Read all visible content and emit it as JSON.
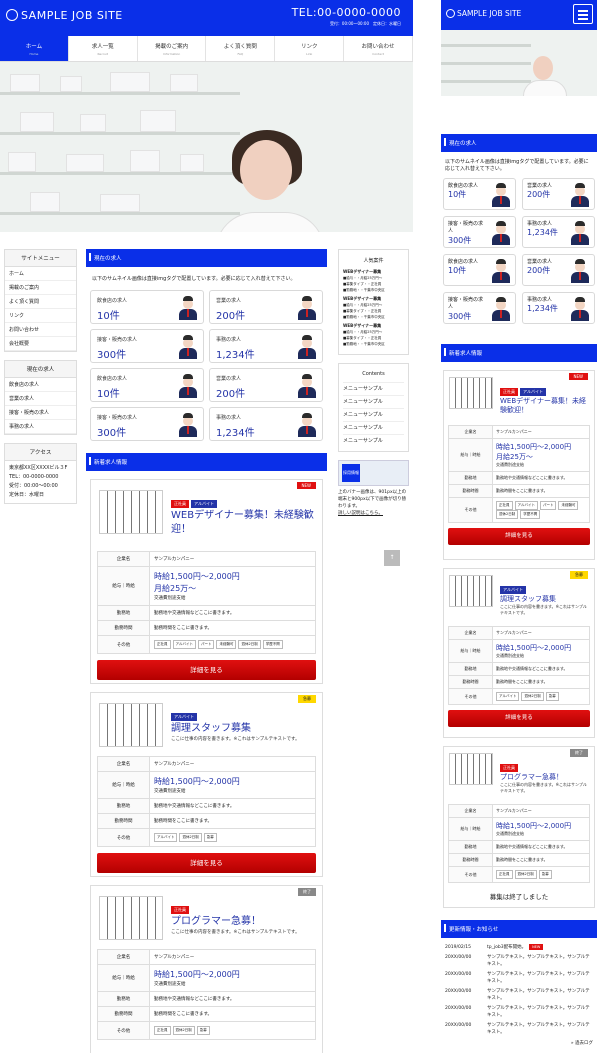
{
  "site": {
    "logo": "SAMPLE JOB SITE",
    "tel": "TEL:00-0000-0000",
    "hours": "受付：00:00〜00:00　定休日：水曜日"
  },
  "nav": [
    {
      "label": "ホーム",
      "sub": "Home"
    },
    {
      "label": "求人一覧",
      "sub": "Recruit"
    },
    {
      "label": "掲載のご案内",
      "sub": "Information"
    },
    {
      "label": "よく頂く質問",
      "sub": "FAQ"
    },
    {
      "label": "リンク",
      "sub": "Link"
    },
    {
      "label": "お問い合わせ",
      "sub": "Contact"
    }
  ],
  "sidebar": {
    "menu_title": "サイトメニュー",
    "menu": [
      "ホーム",
      "掲載のご案内",
      "よく頂く質問",
      "リンク",
      "お問い合わせ",
      "会社概要"
    ],
    "jobs_title": "現在の求人",
    "jobs": [
      "飲食店の求人",
      "営業の求人",
      "接客・販売の求人",
      "事務の求人"
    ],
    "access_title": "アクセス",
    "access": [
      "東京都XX区XXXXビル３F",
      "TEL：00-0000-0000",
      "受付：00:00〜00:00",
      "定休日：水曜日"
    ]
  },
  "current": {
    "title": "現在の求人",
    "note": "以下のサムネイル画像は直接imgタグで配置しています。必要に応じて入れ替えて下さい。",
    "cards": [
      {
        "label": "飲食店の求人",
        "value": "10件"
      },
      {
        "label": "営業の求人",
        "value": "200件"
      },
      {
        "label": "接客・販売の求人",
        "value": "300件"
      },
      {
        "label": "事務の求人",
        "value": "1,234件"
      },
      {
        "label": "飲食店の求人",
        "value": "10件"
      },
      {
        "label": "営業の求人",
        "value": "200件"
      },
      {
        "label": "接客・販売の求人",
        "value": "300件"
      },
      {
        "label": "事務の求人",
        "value": "1,234件"
      }
    ]
  },
  "newjobs": {
    "title": "新着求人情報",
    "keys": {
      "company": "企業名",
      "pay": "給与｜時給",
      "place": "勤務地",
      "time": "勤務時間",
      "other": "その他"
    },
    "detail": "詳細を見る",
    "ended": "募集は終了しました",
    "items": [
      {
        "badges": [
          "正社員",
          "アルバイト"
        ],
        "ribbon": "NEW",
        "title": "WEBデザイナー募集！未経験歓迎！",
        "desc": "",
        "company": "サンプルカンパニー",
        "pay": "時給1,500円〜2,000円",
        "pay2": "月給25万〜",
        "pay_note": "交通費別途支給",
        "place": "勤務地や交通情報などここに書きます。",
        "time": "勤務時間をここに書きます。",
        "chips": [
          "正社員",
          "アルバイト",
          "パート",
          "未経験可",
          "週休2日制",
          "学歴不問"
        ]
      },
      {
        "badges": [
          "アルバイト"
        ],
        "ribbon": "急募",
        "title": "調理スタッフ募集",
        "desc": "ここに仕事の内容を書きます。※これはサンプルテキストです。",
        "company": "サンプルカンパニー",
        "pay": "時給1,500円〜2,000円",
        "pay2": "",
        "pay_note": "交通費別途支給",
        "place": "勤務地や交通情報などここに書きます。",
        "time": "勤務時間をここに書きます。",
        "chips": [
          "アルバイト",
          "週休2日制",
          "急募"
        ]
      },
      {
        "badges": [
          "正社員"
        ],
        "ribbon": "終了",
        "title": "プログラマー急募！",
        "desc": "ここに仕事の内容を書きます。※これはサンプルテキストです。",
        "company": "サンプルカンパニー",
        "pay": "時給1,500円〜2,000円",
        "pay2": "",
        "pay_note": "交通費別途支給",
        "place": "勤務地や交通情報などここに書きます。",
        "time": "勤務時間をここに書きます。",
        "chips": [
          "正社員",
          "週休2日制",
          "急募"
        ]
      }
    ]
  },
  "popular": {
    "title": "人気案件",
    "items": [
      {
        "t": "WEBデザイナー募集",
        "a": "■給与・・月給25万円〜",
        "b": "■募集タイプ・・正社員",
        "c": "■勤務地・・千葉市中央区"
      },
      {
        "t": "WEBデザイナー募集",
        "a": "■給与・・月給25万円〜",
        "b": "■募集タイプ・・正社員",
        "c": "■勤務地・・千葉市中央区"
      },
      {
        "t": "WEBデザイナー募集",
        "a": "■給与・・月給25万円〜",
        "b": "■募集タイプ・・正社員",
        "c": "■勤務地・・千葉市中央区"
      }
    ]
  },
  "contents": {
    "title": "Contents",
    "items": [
      "メニューサンプル",
      "メニューサンプル",
      "メニューサンプル",
      "メニューサンプル",
      "メニューサンプル"
    ]
  },
  "banner": {
    "label": "採用情報",
    "text": "上のバナー画像は、901px以上の端末と900px以下で画像が切り替わります。",
    "link": "詳しい説明はこちら。"
  },
  "updates": {
    "title": "更新情報・お知らせ",
    "rows": [
      {
        "d": "2019/02/15",
        "t": "tp_job3配布開始。",
        "new": "NEW"
      },
      {
        "d": "20XX/00/00",
        "t": "サンプルテキスト。サンプルテキスト。サンプルテキスト。"
      },
      {
        "d": "20XX/00/00",
        "t": "サンプルテキスト。サンプルテキスト。サンプルテキスト。"
      },
      {
        "d": "20XX/00/00",
        "t": "サンプルテキスト。サンプルテキスト。サンプルテキスト。"
      },
      {
        "d": "20XX/00/00",
        "t": "サンプルテキスト。サンプルテキスト。サンプルテキスト。"
      },
      {
        "d": "20XX/00/00",
        "t": "サンプルテキスト。サンプルテキスト。サンプルテキスト。"
      }
    ],
    "more": "» 過去ログ"
  },
  "pagetop": "↑",
  "colors": {
    "brand": "#0a2fe8",
    "accent": "#2434a8",
    "cta": "#d00000"
  }
}
